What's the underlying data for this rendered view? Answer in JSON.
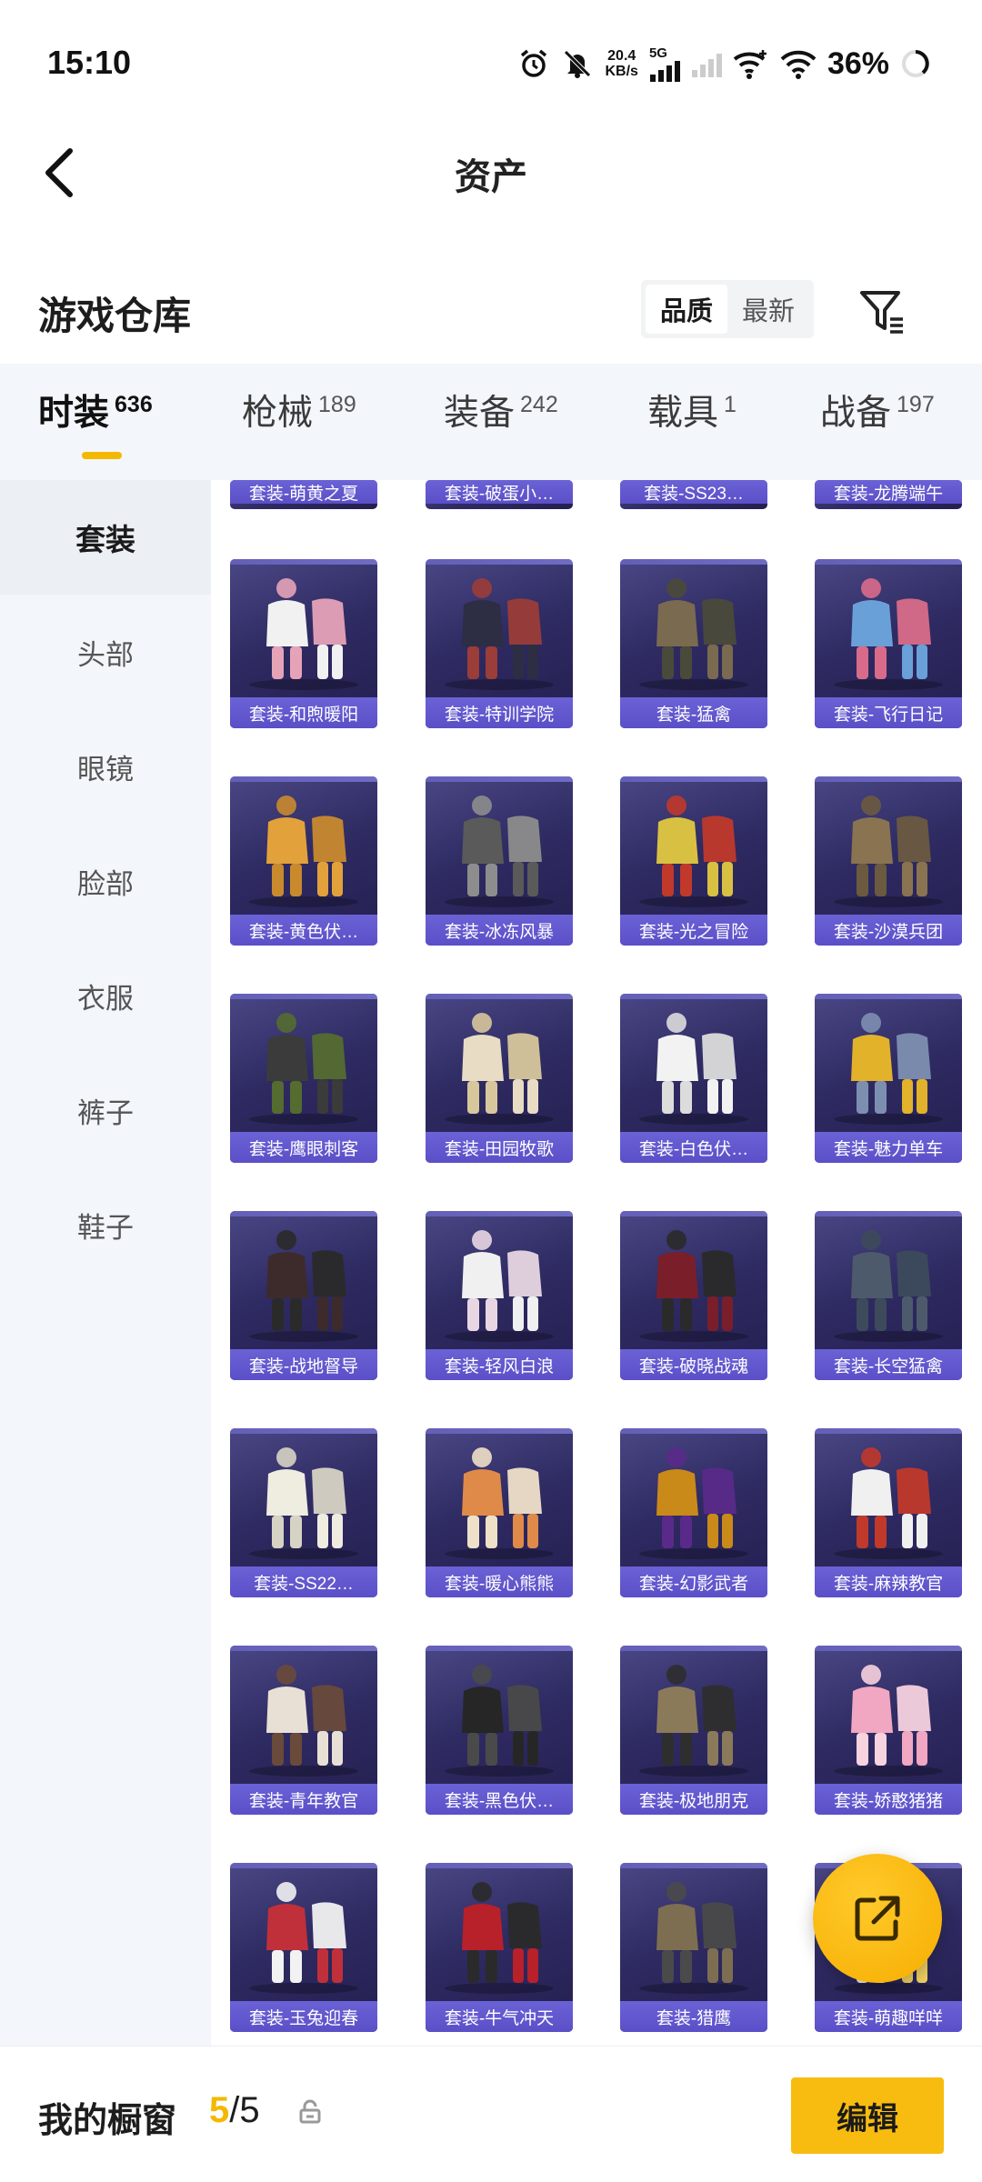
{
  "status_bar": {
    "time": "15:10",
    "net_speed_value": "20.4",
    "net_speed_unit": "KB/s",
    "network": "5G",
    "battery": "36%"
  },
  "header": {
    "title": "资产"
  },
  "warehouse": {
    "title": "游戏仓库",
    "sort_options": [
      "品质",
      "最新"
    ],
    "active_sort": "品质"
  },
  "categories": [
    {
      "label": "时装",
      "count": "636",
      "active": true
    },
    {
      "label": "枪械",
      "count": "189",
      "active": false
    },
    {
      "label": "装备",
      "count": "242",
      "active": false
    },
    {
      "label": "载具",
      "count": "1",
      "active": false
    },
    {
      "label": "战备",
      "count": "197",
      "active": false
    }
  ],
  "sidebar": {
    "items": [
      "套装",
      "头部",
      "眼镜",
      "脸部",
      "衣服",
      "裤子",
      "鞋子"
    ],
    "active": "套装"
  },
  "items_partial_row": [
    "套装-萌黄之夏",
    "套装-破蛋小…",
    "套装-SS23…",
    "套装-龙腾端午"
  ],
  "items": [
    "套装-和煦暖阳",
    "套装-特训学院",
    "套装-猛禽",
    "套装-飞行日记",
    "套装-黄色伏…",
    "套装-冰冻风暴",
    "套装-光之冒险",
    "套装-沙漠兵团",
    "套装-鹰眼刺客",
    "套装-田园牧歌",
    "套装-白色伏…",
    "套装-魅力单车",
    "套装-战地督导",
    "套装-轻风白浪",
    "套装-破晓战魂",
    "套装-长空猛禽",
    "套装-SS22…",
    "套装-暖心熊熊",
    "套装-幻影武者",
    "套装-麻辣教官",
    "套装-青年教官",
    "套装-黑色伏…",
    "套装-极地朋克",
    "套装-娇憨猪猪",
    "套装-玉兔迎春",
    "套装-牛气冲天",
    "套装-猎鹰",
    "套装-萌趣咩咩"
  ],
  "showcase": {
    "title": "我的橱窗",
    "current": "5",
    "total": "/5",
    "edit_label": "编辑"
  },
  "colors": {
    "accent": "#f5b800",
    "card_bg": "#2f2b63",
    "card_label": "#5b4fc7"
  }
}
